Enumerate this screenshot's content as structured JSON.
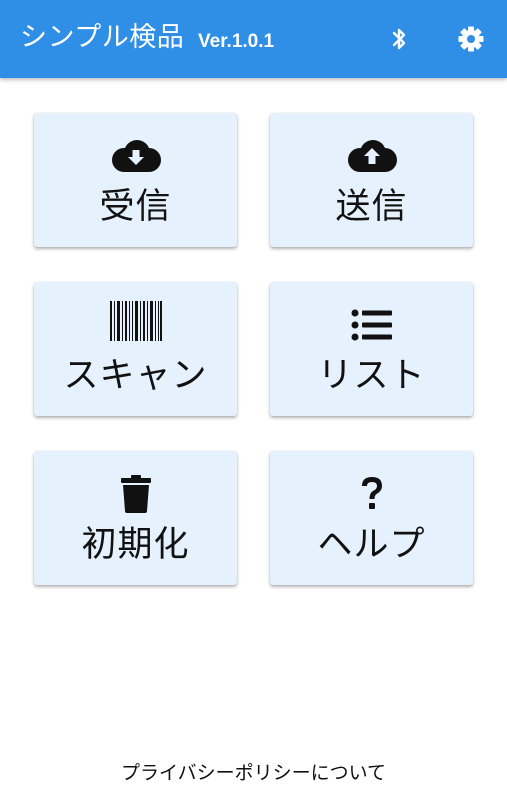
{
  "appbar": {
    "title": "シンプル検品",
    "version": "Ver.1.0.1",
    "bluetooth_icon": "bluetooth-icon",
    "settings_icon": "gear-icon",
    "background_color": "#2f8ee5"
  },
  "menu": {
    "receive": {
      "label": "受信",
      "icon": "cloud-download-icon"
    },
    "send": {
      "label": "送信",
      "icon": "cloud-upload-icon"
    },
    "scan": {
      "label": "スキャン",
      "icon": "barcode-icon"
    },
    "list": {
      "label": "リスト",
      "icon": "list-icon"
    },
    "reset": {
      "label": "初期化",
      "icon": "trash-icon"
    },
    "help": {
      "label": "ヘルプ",
      "icon": "question-mark-icon"
    },
    "tile_color": "#e5f1fd"
  },
  "footer": {
    "privacy_link": "プライバシーポリシーについて"
  }
}
